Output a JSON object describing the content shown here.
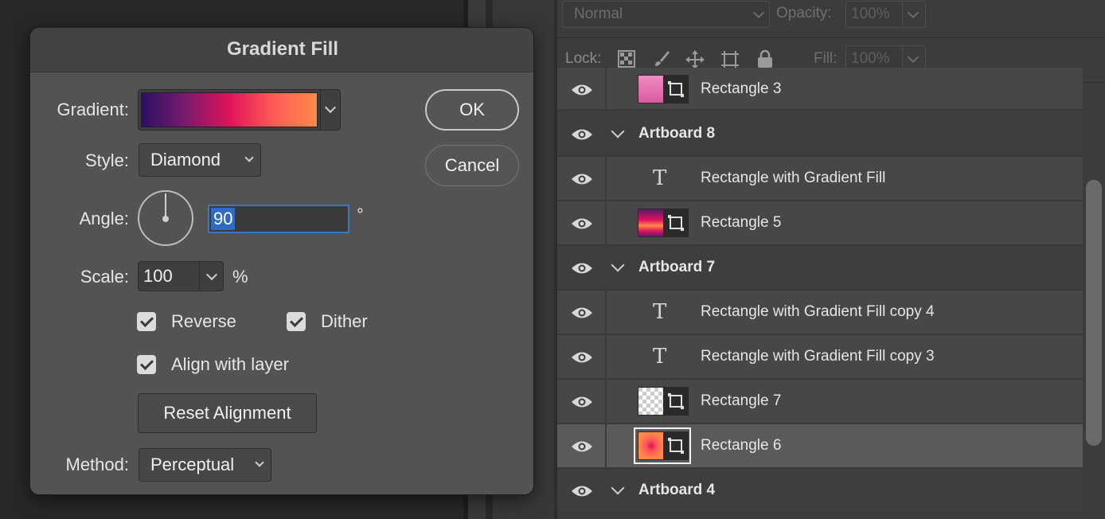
{
  "dialog": {
    "title": "Gradient Fill",
    "gradient_label": "Gradient:",
    "style_label": "Style:",
    "style_value": "Diamond",
    "angle_label": "Angle:",
    "angle_value": "90",
    "degree_symbol": "°",
    "scale_label": "Scale:",
    "scale_value": "100",
    "percent_symbol": "%",
    "reverse_label": "Reverse",
    "reverse_checked": true,
    "dither_label": "Dither",
    "dither_checked": true,
    "align_label": "Align with layer",
    "align_checked": true,
    "reset_label": "Reset Alignment",
    "method_label": "Method:",
    "method_value": "Perceptual",
    "ok_label": "OK",
    "cancel_label": "Cancel",
    "gradient_colors": [
      "#2a1164",
      "#7b1a6e",
      "#e0125a",
      "#ff5a56",
      "#ff8a48"
    ]
  },
  "panel": {
    "blend_mode": "Normal",
    "opacity_label": "Opacity:",
    "opacity_value": "100%",
    "lock_label": "Lock:",
    "fill_label": "Fill:",
    "fill_value": "100%"
  },
  "layers": [
    {
      "name": "Rectangle 3",
      "kind": "shape"
    },
    {
      "name": "Artboard 8",
      "kind": "group"
    },
    {
      "name": "Rectangle with Gradient Fill",
      "kind": "text"
    },
    {
      "name": "Rectangle 5",
      "kind": "shape"
    },
    {
      "name": "Artboard 7",
      "kind": "group"
    },
    {
      "name": "Rectangle with Gradient Fill copy 4",
      "kind": "text"
    },
    {
      "name": "Rectangle with Gradient Fill copy 3",
      "kind": "text"
    },
    {
      "name": "Rectangle 7",
      "kind": "shape"
    },
    {
      "name": "Rectangle 6",
      "kind": "shape",
      "selected": true
    },
    {
      "name": "Artboard 4",
      "kind": "group"
    }
  ]
}
